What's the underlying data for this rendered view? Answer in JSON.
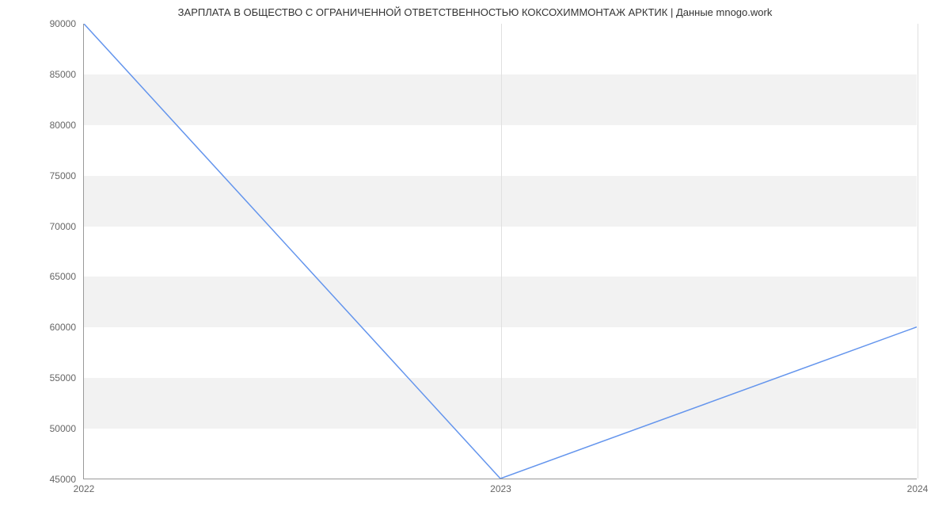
{
  "chart_data": {
    "type": "line",
    "title": "ЗАРПЛАТА В ОБЩЕСТВО С ОГРАНИЧЕННОЙ  ОТВЕТСТВЕННОСТЬЮ КОКСОХИММОНТАЖ АРКТИК | Данные mnogo.work",
    "x": [
      2022,
      2023,
      2024
    ],
    "values": [
      90000,
      45000,
      60000
    ],
    "xlim": [
      2022,
      2024
    ],
    "ylim": [
      45000,
      90000
    ],
    "y_ticks": [
      45000,
      50000,
      55000,
      60000,
      65000,
      70000,
      75000,
      80000,
      85000,
      90000
    ],
    "x_ticks": [
      2022,
      2023,
      2024
    ],
    "line_color": "#6495ED",
    "band_color": "#f2f2f2"
  }
}
